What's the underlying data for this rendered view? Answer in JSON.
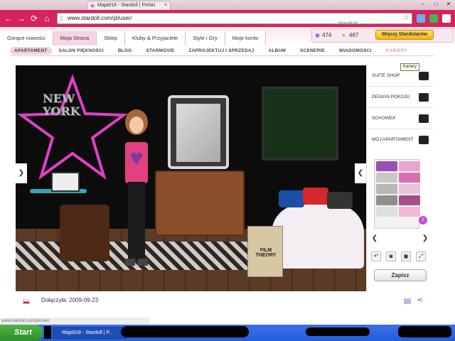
{
  "browser": {
    "tab_title": "Maja918 - Stardoll | Polski",
    "url": "www.stardoll.com/pl/user/",
    "status_url": "www.stardoll.com/pl/user/"
  },
  "site": {
    "username": "Maja918",
    "stardollars": "474",
    "coins": "467",
    "more_stardollars": "Więcej Stardolarów",
    "menu": [
      "Gorące nowości",
      "Moja Strona",
      "Sklep",
      "Kluby & Przyjaciele",
      "Style i Gry",
      "Moje konto"
    ],
    "submenu": [
      "APARTAMENT",
      "SALON PIĘKNOŚCI",
      "BLOG",
      "STARMOVIE",
      "ZAPROJEKTUJ I SPRZEDAJ",
      "ALBUM",
      "SCENERIE",
      "WIADOMOŚCI",
      "KARIERY"
    ]
  },
  "room": {
    "neon_text": [
      "NEW",
      "YORK"
    ],
    "bag_label": "FILM THEORY"
  },
  "side_panel": {
    "tooltip": "Kariery",
    "items": [
      "SUITE SHOP",
      "DESIGN POKOJU",
      "SCHOWEK",
      "MÓJ APARTAMENT"
    ],
    "page_badge": "2",
    "save": "Zapisz"
  },
  "footer": {
    "joined": "Dołączyła: 2009-09-23"
  },
  "taskbar": {
    "start": "Start",
    "item": "Maja918 - Stardoll | P..."
  },
  "colors": {
    "brand_pink": "#d6235f",
    "accent_gold": "#f5b400",
    "neon_pink": "#e040c8"
  }
}
